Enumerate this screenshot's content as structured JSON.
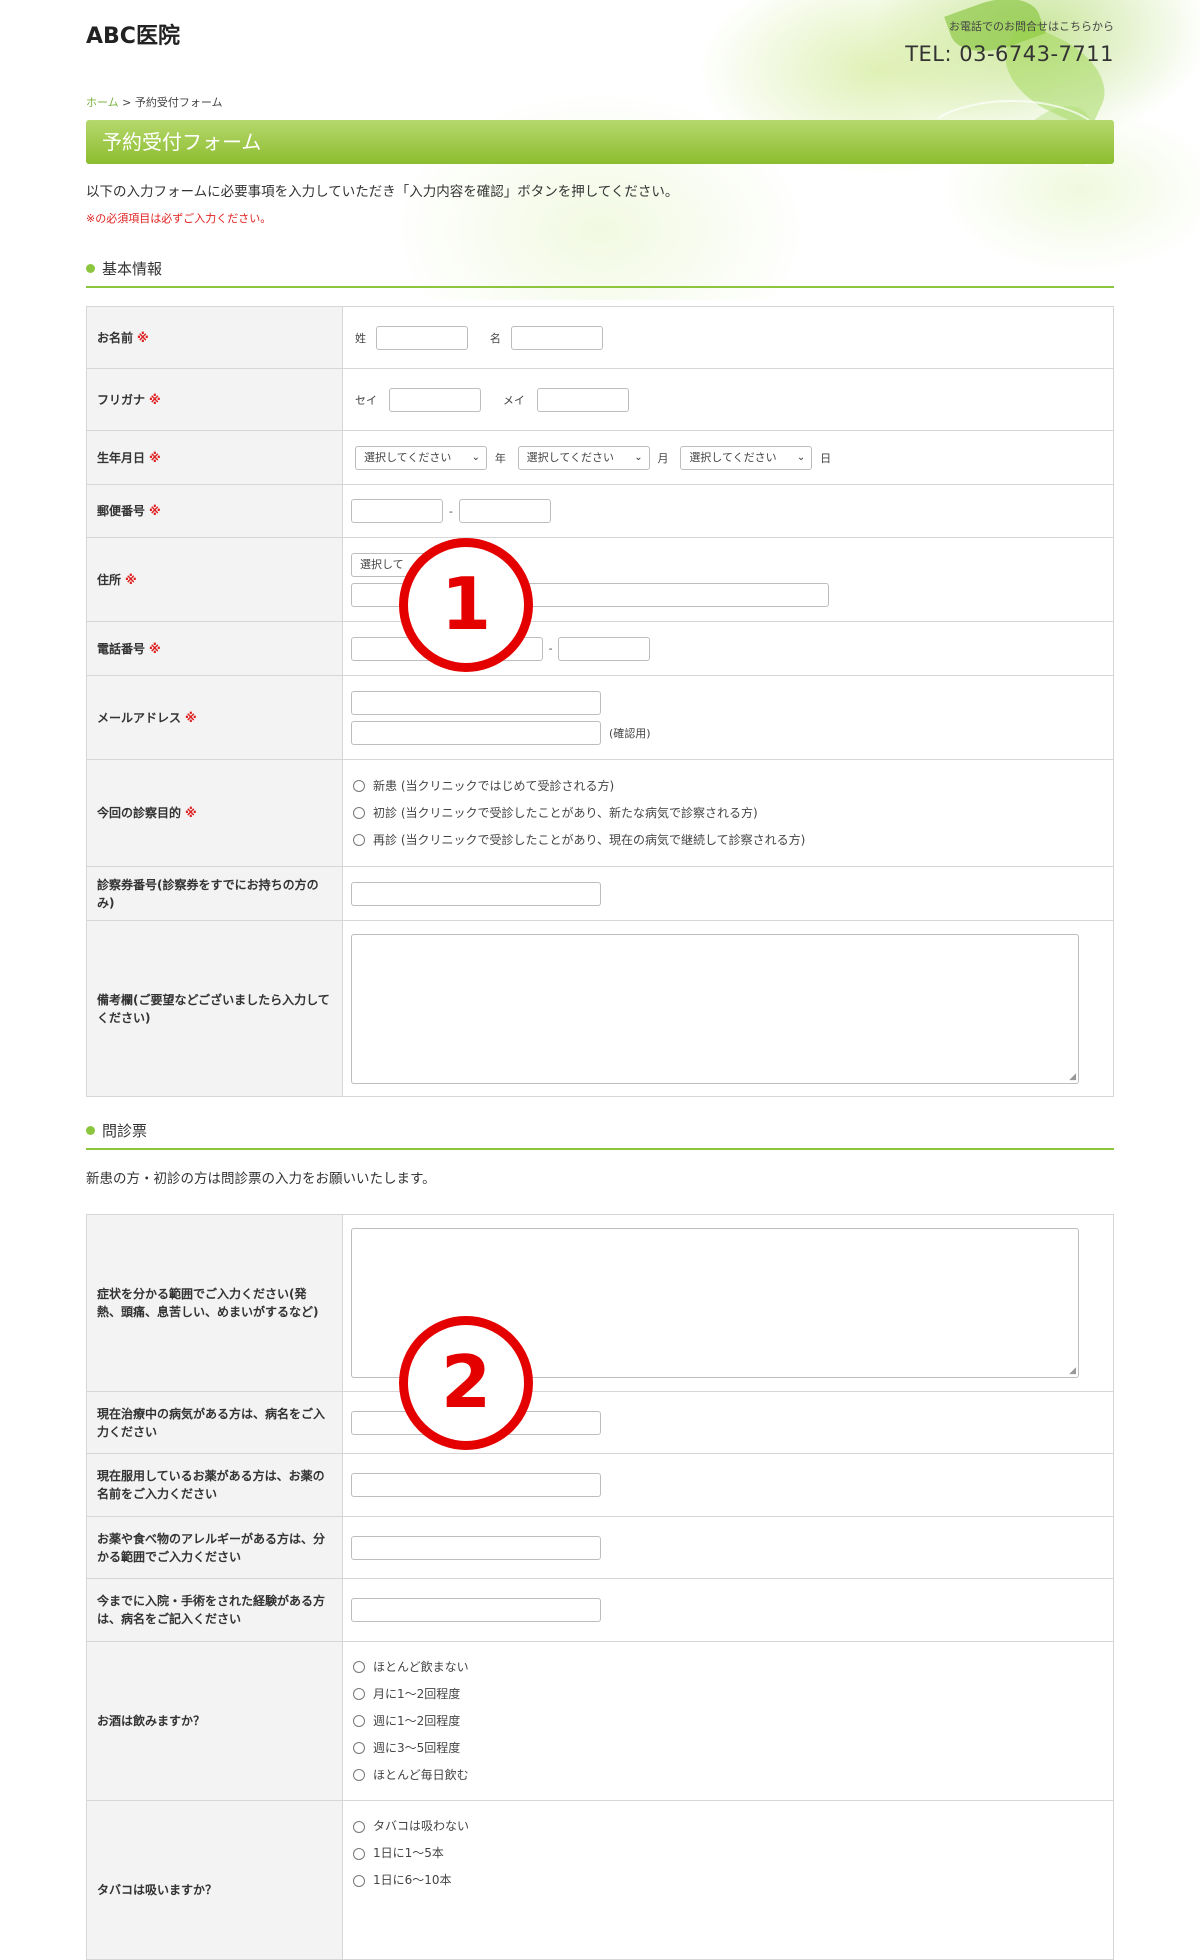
{
  "header": {
    "logo": "ABC医院",
    "tel_note": "お電話でのお問合せはこちらから",
    "tel": "TEL: 03-6743-7711"
  },
  "breadcrumb": {
    "home": "ホーム",
    "separator": ">",
    "current": "予約受付フォーム"
  },
  "page_title": "予約受付フォーム",
  "intro": "以下の入力フォームに必要事項を入力していただき「入力内容を確認」ボタンを押してください。",
  "required_note": "※の必須項目は必ずご入力ください。",
  "required_mark": "※",
  "basic": {
    "heading": "基本情報",
    "name": {
      "label": "お名前",
      "sei": "姓",
      "mei": "名"
    },
    "kana": {
      "label": "フリガナ",
      "sei": "セイ",
      "mei": "メイ"
    },
    "birth": {
      "label": "生年月日",
      "select_placeholder": "選択してください",
      "year": "年",
      "month": "月",
      "day": "日"
    },
    "zip": {
      "label": "郵便番号",
      "dash": "-"
    },
    "address": {
      "label": "住所",
      "select_placeholder": "選択して"
    },
    "phone": {
      "label": "電話番号",
      "dash": "-"
    },
    "email": {
      "label": "メールアドレス",
      "confirm": "(確認用)"
    },
    "purpose": {
      "label": "今回の診察目的",
      "options": [
        "新患 (当クリニックではじめて受診される方)",
        "初診 (当クリニックで受診したことがあり、新たな病気で診察される方)",
        "再診 (当クリニックで受診したことがあり、現在の病気で継続して診察される方)"
      ]
    },
    "card": {
      "label": "診察券番号(診察券をすでにお持ちの方のみ)"
    },
    "remarks": {
      "label": "備考欄(ご要望などございましたら入力してください)"
    }
  },
  "questionnaire": {
    "heading": "問診票",
    "note": "新患の方・初診の方は問診票の入力をお願いいたします。",
    "symptoms": {
      "label": "症状を分かる範囲でご入力ください(発熱、頭痛、息苦しい、めまいがするなど)"
    },
    "disease": {
      "label": "現在治療中の病気がある方は、病名をご入力ください"
    },
    "medicine": {
      "label": "現在服用しているお薬がある方は、お薬の名前をご入力ください"
    },
    "allergy": {
      "label": "お薬や食べ物のアレルギーがある方は、分かる範囲でご入力ください"
    },
    "history": {
      "label": "今までに入院・手術をされた経験がある方は、病名をご記入ください"
    },
    "alcohol": {
      "label": "お酒は飲みますか？",
      "options": [
        "ほとんど飲まない",
        "月に1～2回程度",
        "週に1～2回程度",
        "週に3～5回程度",
        "ほとんど毎日飲む"
      ]
    },
    "tobacco": {
      "label": "タバコは吸いますか？",
      "options": [
        "タバコは吸わない",
        "1日に1～5本",
        "1日に6～10本"
      ]
    }
  },
  "annotations": {
    "marker_1": "1",
    "marker_2": "2"
  },
  "colors": {
    "accent_green": "#8cc63f",
    "required_red": "#e02020",
    "marker_red": "#e50000"
  }
}
